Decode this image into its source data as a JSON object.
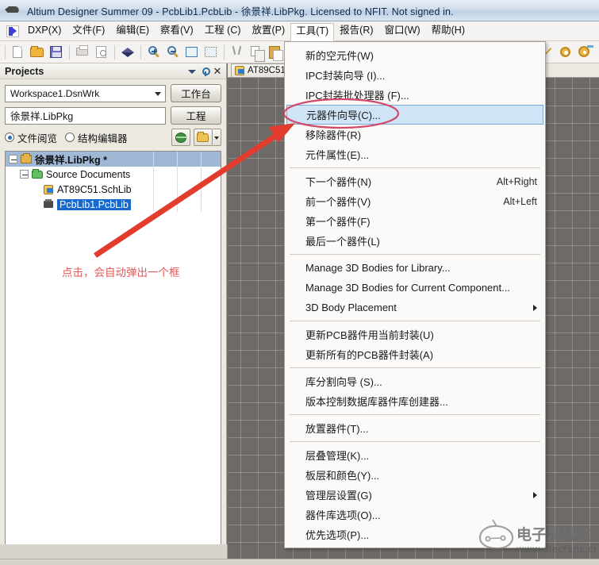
{
  "window": {
    "title": "Altium Designer Summer 09 - PcbLib1.PcbLib - 徐景祥.LibPkg. Licensed to NFIT. Not signed in.",
    "icon": "altium-pen-icon"
  },
  "menubar": {
    "logo": "dxp-logo-icon",
    "items": [
      {
        "label": "DXP(X)",
        "open": false
      },
      {
        "label": "文件(F)",
        "open": false
      },
      {
        "label": "编辑(E)",
        "open": false
      },
      {
        "label": "察看(V)",
        "open": false
      },
      {
        "label": "工程 (C)",
        "open": false
      },
      {
        "label": "放置(P)",
        "open": false
      },
      {
        "label": "工具(T)",
        "open": true
      },
      {
        "label": "报告(R)",
        "open": false
      },
      {
        "label": "窗口(W)",
        "open": false
      },
      {
        "label": "帮助(H)",
        "open": false
      }
    ]
  },
  "toolbar": {
    "groups": [
      [
        "new-document-icon",
        "open-folder-icon",
        "save-icon"
      ],
      [
        "print-icon",
        "print-preview-icon"
      ],
      [
        "layer-stack-icon"
      ],
      [
        "zoom-in-icon",
        "zoom-out-icon",
        "zoom-fit-icon",
        "zoom-area-icon"
      ],
      [
        "cut-icon",
        "copy-icon",
        "paste-icon",
        "paste-special-icon"
      ]
    ],
    "right_groups": [
      [
        "place-line-icon",
        "place-pad-icon",
        "place-via-icon"
      ]
    ]
  },
  "panel": {
    "title": "Projects",
    "header_buttons": [
      "chevron-down-icon",
      "pin-icon",
      "close-icon"
    ],
    "workspace_combo": {
      "value": "Workspace1.DsnWrk",
      "button": "工作台"
    },
    "project_box": {
      "value": "徐景祥.LibPkg",
      "button": "工程"
    },
    "view_modes": [
      {
        "label": "文件阅览",
        "selected": true
      },
      {
        "label": "结构编辑器",
        "selected": false
      }
    ],
    "view_icon_buttons": [
      "globe-icon",
      "folder-icon",
      "chevron-down-icon"
    ],
    "tree": [
      {
        "label": "徐景祥.LibPkg *",
        "icon": "library-package-icon",
        "depth": 0,
        "state": "soft-selected",
        "bold": true,
        "expander": true
      },
      {
        "label": "Source Documents",
        "icon": "folder-icon",
        "depth": 1,
        "state": "none",
        "bold": false,
        "expander": true
      },
      {
        "label": "AT89C51.SchLib",
        "icon": "schematic-library-icon",
        "depth": 2,
        "state": "none",
        "bold": false,
        "expander": false
      },
      {
        "label": "PcbLib1.PcbLib",
        "icon": "pcb-library-icon",
        "depth": 2,
        "state": "selected",
        "bold": false,
        "expander": false
      }
    ],
    "annotation": "点击，会自动弹出一个框"
  },
  "document_tabs": [
    {
      "label": "AT89C51",
      "icon": "schematic-library-icon",
      "active": true
    }
  ],
  "tools_menu": {
    "items": [
      {
        "label": "新的空元件(W)",
        "accel": "",
        "type": "item",
        "highlighted": false,
        "submenu": false
      },
      {
        "label": "IPC封装向导 (I)...",
        "accel": "",
        "type": "item",
        "highlighted": false,
        "submenu": false
      },
      {
        "label": "IPC封装批处理器 (F)...",
        "accel": "",
        "type": "item",
        "highlighted": false,
        "submenu": false
      },
      {
        "label": "元器件向导(C)...",
        "accel": "",
        "type": "item",
        "highlighted": true,
        "submenu": false
      },
      {
        "label": "移除器件(R)",
        "accel": "",
        "type": "item",
        "highlighted": false,
        "submenu": false
      },
      {
        "label": "元件属性(E)...",
        "accel": "",
        "type": "item",
        "highlighted": false,
        "submenu": false
      },
      {
        "type": "separator"
      },
      {
        "label": "下一个器件(N)",
        "accel": "Alt+Right",
        "type": "item",
        "highlighted": false,
        "submenu": false
      },
      {
        "label": "前一个器件(V)",
        "accel": "Alt+Left",
        "type": "item",
        "highlighted": false,
        "submenu": false
      },
      {
        "label": "第一个器件(F)",
        "accel": "",
        "type": "item",
        "highlighted": false,
        "submenu": false
      },
      {
        "label": "最后一个器件(L)",
        "accel": "",
        "type": "item",
        "highlighted": false,
        "submenu": false
      },
      {
        "type": "separator"
      },
      {
        "label": "Manage 3D Bodies for Library...",
        "accel": "",
        "type": "item",
        "highlighted": false,
        "submenu": false
      },
      {
        "label": "Manage 3D Bodies for Current Component...",
        "accel": "",
        "type": "item",
        "highlighted": false,
        "submenu": false
      },
      {
        "label": "3D Body Placement",
        "accel": "",
        "type": "item",
        "highlighted": false,
        "submenu": true
      },
      {
        "type": "separator"
      },
      {
        "label": "更新PCB器件用当前封装(U)",
        "accel": "",
        "type": "item",
        "highlighted": false,
        "submenu": false
      },
      {
        "label": "更新所有的PCB器件封装(A)",
        "accel": "",
        "type": "item",
        "highlighted": false,
        "submenu": false
      },
      {
        "type": "separator"
      },
      {
        "label": "库分割向导 (S)...",
        "accel": "",
        "type": "item",
        "highlighted": false,
        "submenu": false
      },
      {
        "label": "版本控制数据库器件库创建器...",
        "accel": "",
        "type": "item",
        "highlighted": false,
        "submenu": false
      },
      {
        "type": "separator"
      },
      {
        "label": "放置器件(T)...",
        "accel": "",
        "type": "item",
        "highlighted": false,
        "submenu": false
      },
      {
        "type": "separator"
      },
      {
        "label": "层叠管理(K)...",
        "accel": "",
        "type": "item",
        "highlighted": false,
        "submenu": false
      },
      {
        "label": "板层和颜色(Y)...",
        "accel": "",
        "type": "item",
        "highlighted": false,
        "submenu": false
      },
      {
        "label": "管理层设置(G)",
        "accel": "",
        "type": "item",
        "highlighted": false,
        "submenu": true
      },
      {
        "label": "器件库选项(O)...",
        "accel": "",
        "type": "item",
        "highlighted": false,
        "submenu": false
      },
      {
        "label": "优先选项(P)...",
        "accel": "",
        "type": "item",
        "highlighted": false,
        "submenu": false
      }
    ]
  },
  "annotations": {
    "arrow_color": "#e23c2e",
    "ellipse_color": "#d24a6a",
    "note_color": "#e05a5a"
  },
  "watermark": {
    "brand": "电子发烧友",
    "url": "www.elecfans.com"
  }
}
